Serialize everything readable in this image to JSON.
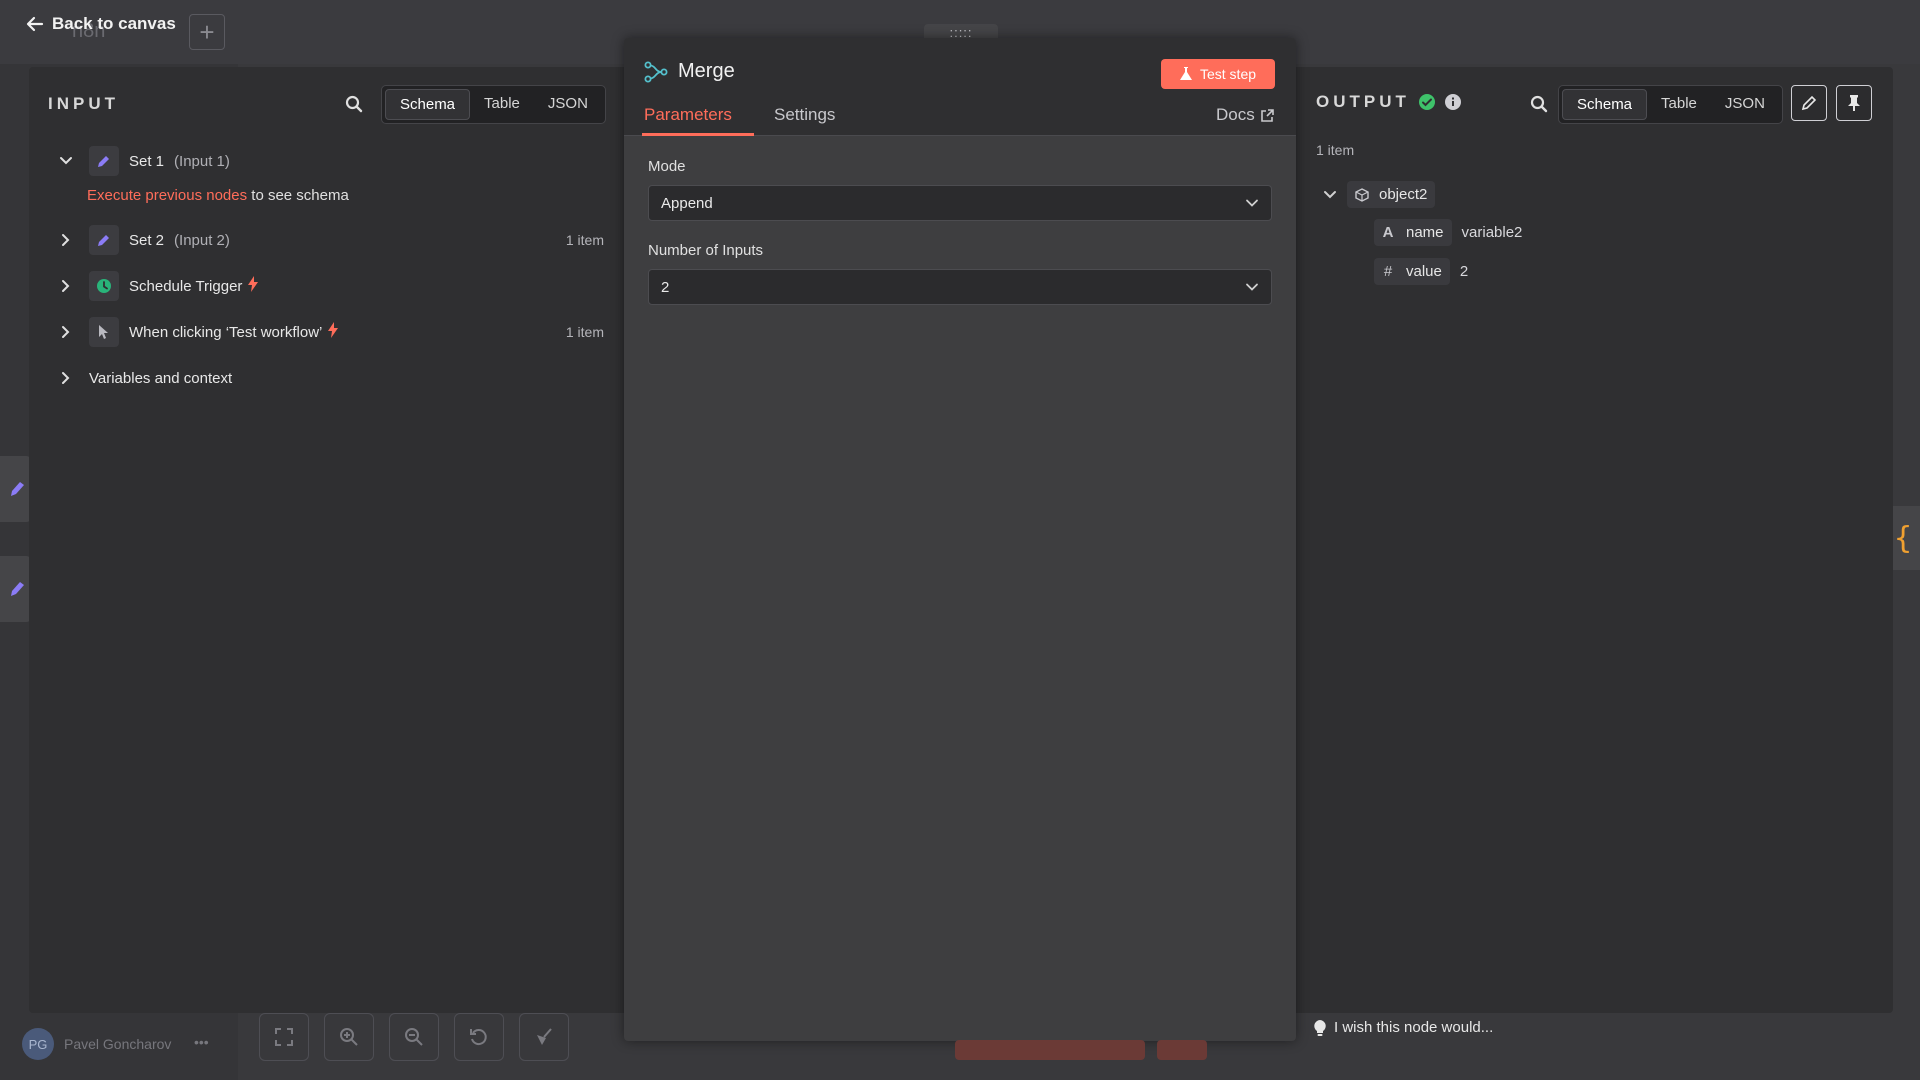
{
  "background": {
    "workflow_title": "n8n",
    "user": {
      "initials": "PG",
      "name": "Pavel Goncharov",
      "menu": "•••"
    }
  },
  "header": {
    "back_label": "Back to canvas",
    "add_label": "+"
  },
  "input_panel": {
    "title": "INPUT",
    "views": [
      "Schema",
      "Table",
      "JSON"
    ],
    "active_view": "Schema",
    "nodes": [
      {
        "name": "Set 1",
        "input": "(Input 1)",
        "count": "",
        "icon": "pencil-icon",
        "expanded": true
      },
      {
        "name": "Set 2",
        "input": "(Input 2)",
        "count": "1 item",
        "icon": "pencil-icon",
        "expanded": false
      },
      {
        "name": "Schedule Trigger",
        "input": "",
        "count": "",
        "icon": "clock-icon",
        "trigger": true
      },
      {
        "name": "When clicking ‘Test workflow’",
        "input": "",
        "count": "1 item",
        "icon": "cursor-icon",
        "trigger": true
      }
    ],
    "hint_link": "Execute previous nodes",
    "hint_text": "to see schema",
    "variables_label": "Variables and context"
  },
  "node_panel": {
    "drag_handle": ":::::",
    "title": "Merge",
    "test_button": "Test step",
    "tabs": [
      "Parameters",
      "Settings"
    ],
    "active_tab": "Parameters",
    "docs_label": "Docs",
    "fields": [
      {
        "label": "Mode",
        "value": "Append"
      },
      {
        "label": "Number of Inputs",
        "value": "2"
      }
    ]
  },
  "output_panel": {
    "title": "OUTPUT",
    "views": [
      "Schema",
      "Table",
      "JSON"
    ],
    "active_view": "Schema",
    "item_count": "1 item",
    "object_name": "object2",
    "fields": [
      {
        "type": "A",
        "key": "name",
        "value": "variable2"
      },
      {
        "type": "#",
        "key": "value",
        "value": "2"
      }
    ]
  },
  "feedback": {
    "label": "I wish this node would..."
  },
  "colors": {
    "accent": "#ff6d5a",
    "success": "#3ec26a",
    "node_pencil": "#8b7cf6",
    "trigger_green": "#29b47a"
  }
}
